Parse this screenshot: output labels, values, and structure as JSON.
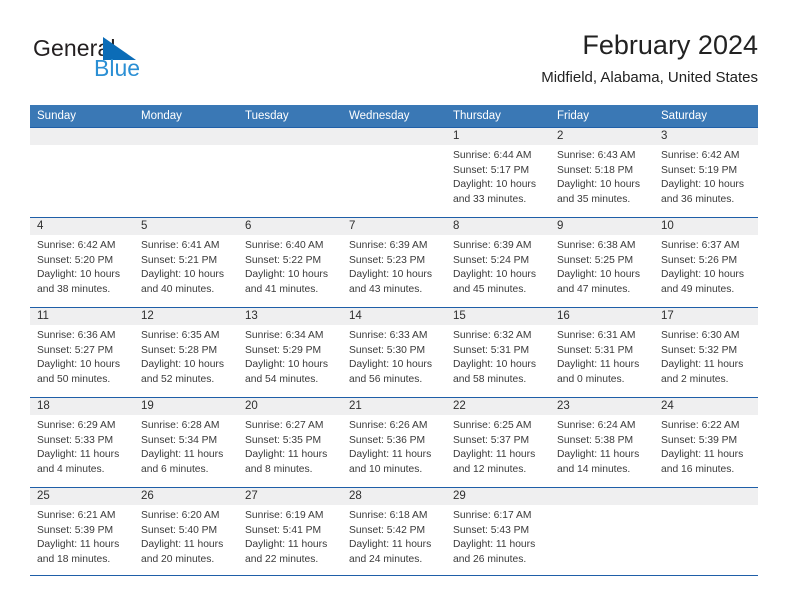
{
  "brand": {
    "name_part1": "General",
    "name_part2": "Blue",
    "logo_icon": "triangle-flag-icon"
  },
  "header": {
    "month_title": "February 2024",
    "location": "Midfield, Alabama, United States"
  },
  "colors": {
    "header_blue": "#3a78b5",
    "rule_blue": "#1f5fa8",
    "daynum_band": "#efeff0",
    "brand_dark": "#231f20",
    "brand_blue": "#2b8fd4"
  },
  "calendar": {
    "weekday_headers": [
      "Sunday",
      "Monday",
      "Tuesday",
      "Wednesday",
      "Thursday",
      "Friday",
      "Saturday"
    ],
    "weeks": [
      [
        {
          "day": "",
          "lines": []
        },
        {
          "day": "",
          "lines": []
        },
        {
          "day": "",
          "lines": []
        },
        {
          "day": "",
          "lines": []
        },
        {
          "day": "1",
          "lines": [
            "Sunrise: 6:44 AM",
            "Sunset: 5:17 PM",
            "Daylight: 10 hours",
            "and 33 minutes."
          ]
        },
        {
          "day": "2",
          "lines": [
            "Sunrise: 6:43 AM",
            "Sunset: 5:18 PM",
            "Daylight: 10 hours",
            "and 35 minutes."
          ]
        },
        {
          "day": "3",
          "lines": [
            "Sunrise: 6:42 AM",
            "Sunset: 5:19 PM",
            "Daylight: 10 hours",
            "and 36 minutes."
          ]
        }
      ],
      [
        {
          "day": "4",
          "lines": [
            "Sunrise: 6:42 AM",
            "Sunset: 5:20 PM",
            "Daylight: 10 hours",
            "and 38 minutes."
          ]
        },
        {
          "day": "5",
          "lines": [
            "Sunrise: 6:41 AM",
            "Sunset: 5:21 PM",
            "Daylight: 10 hours",
            "and 40 minutes."
          ]
        },
        {
          "day": "6",
          "lines": [
            "Sunrise: 6:40 AM",
            "Sunset: 5:22 PM",
            "Daylight: 10 hours",
            "and 41 minutes."
          ]
        },
        {
          "day": "7",
          "lines": [
            "Sunrise: 6:39 AM",
            "Sunset: 5:23 PM",
            "Daylight: 10 hours",
            "and 43 minutes."
          ]
        },
        {
          "day": "8",
          "lines": [
            "Sunrise: 6:39 AM",
            "Sunset: 5:24 PM",
            "Daylight: 10 hours",
            "and 45 minutes."
          ]
        },
        {
          "day": "9",
          "lines": [
            "Sunrise: 6:38 AM",
            "Sunset: 5:25 PM",
            "Daylight: 10 hours",
            "and 47 minutes."
          ]
        },
        {
          "day": "10",
          "lines": [
            "Sunrise: 6:37 AM",
            "Sunset: 5:26 PM",
            "Daylight: 10 hours",
            "and 49 minutes."
          ]
        }
      ],
      [
        {
          "day": "11",
          "lines": [
            "Sunrise: 6:36 AM",
            "Sunset: 5:27 PM",
            "Daylight: 10 hours",
            "and 50 minutes."
          ]
        },
        {
          "day": "12",
          "lines": [
            "Sunrise: 6:35 AM",
            "Sunset: 5:28 PM",
            "Daylight: 10 hours",
            "and 52 minutes."
          ]
        },
        {
          "day": "13",
          "lines": [
            "Sunrise: 6:34 AM",
            "Sunset: 5:29 PM",
            "Daylight: 10 hours",
            "and 54 minutes."
          ]
        },
        {
          "day": "14",
          "lines": [
            "Sunrise: 6:33 AM",
            "Sunset: 5:30 PM",
            "Daylight: 10 hours",
            "and 56 minutes."
          ]
        },
        {
          "day": "15",
          "lines": [
            "Sunrise: 6:32 AM",
            "Sunset: 5:31 PM",
            "Daylight: 10 hours",
            "and 58 minutes."
          ]
        },
        {
          "day": "16",
          "lines": [
            "Sunrise: 6:31 AM",
            "Sunset: 5:31 PM",
            "Daylight: 11 hours",
            "and 0 minutes."
          ]
        },
        {
          "day": "17",
          "lines": [
            "Sunrise: 6:30 AM",
            "Sunset: 5:32 PM",
            "Daylight: 11 hours",
            "and 2 minutes."
          ]
        }
      ],
      [
        {
          "day": "18",
          "lines": [
            "Sunrise: 6:29 AM",
            "Sunset: 5:33 PM",
            "Daylight: 11 hours",
            "and 4 minutes."
          ]
        },
        {
          "day": "19",
          "lines": [
            "Sunrise: 6:28 AM",
            "Sunset: 5:34 PM",
            "Daylight: 11 hours",
            "and 6 minutes."
          ]
        },
        {
          "day": "20",
          "lines": [
            "Sunrise: 6:27 AM",
            "Sunset: 5:35 PM",
            "Daylight: 11 hours",
            "and 8 minutes."
          ]
        },
        {
          "day": "21",
          "lines": [
            "Sunrise: 6:26 AM",
            "Sunset: 5:36 PM",
            "Daylight: 11 hours",
            "and 10 minutes."
          ]
        },
        {
          "day": "22",
          "lines": [
            "Sunrise: 6:25 AM",
            "Sunset: 5:37 PM",
            "Daylight: 11 hours",
            "and 12 minutes."
          ]
        },
        {
          "day": "23",
          "lines": [
            "Sunrise: 6:24 AM",
            "Sunset: 5:38 PM",
            "Daylight: 11 hours",
            "and 14 minutes."
          ]
        },
        {
          "day": "24",
          "lines": [
            "Sunrise: 6:22 AM",
            "Sunset: 5:39 PM",
            "Daylight: 11 hours",
            "and 16 minutes."
          ]
        }
      ],
      [
        {
          "day": "25",
          "lines": [
            "Sunrise: 6:21 AM",
            "Sunset: 5:39 PM",
            "Daylight: 11 hours",
            "and 18 minutes."
          ]
        },
        {
          "day": "26",
          "lines": [
            "Sunrise: 6:20 AM",
            "Sunset: 5:40 PM",
            "Daylight: 11 hours",
            "and 20 minutes."
          ]
        },
        {
          "day": "27",
          "lines": [
            "Sunrise: 6:19 AM",
            "Sunset: 5:41 PM",
            "Daylight: 11 hours",
            "and 22 minutes."
          ]
        },
        {
          "day": "28",
          "lines": [
            "Sunrise: 6:18 AM",
            "Sunset: 5:42 PM",
            "Daylight: 11 hours",
            "and 24 minutes."
          ]
        },
        {
          "day": "29",
          "lines": [
            "Sunrise: 6:17 AM",
            "Sunset: 5:43 PM",
            "Daylight: 11 hours",
            "and 26 minutes."
          ]
        },
        {
          "day": "",
          "lines": []
        },
        {
          "day": "",
          "lines": []
        }
      ]
    ]
  }
}
